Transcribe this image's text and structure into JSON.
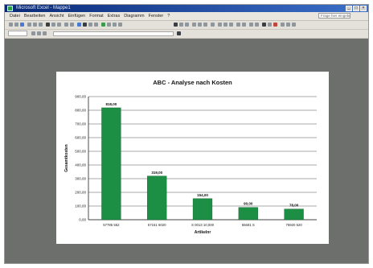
{
  "window": {
    "title": "Microsoft Excel - Mappe1",
    "controls": [
      "_",
      "□",
      "×"
    ]
  },
  "menubar": {
    "items": [
      "Datei",
      "Bearbeiten",
      "Ansicht",
      "Einfügen",
      "Format",
      "Extras",
      "Diagramm",
      "Fenster",
      "?"
    ],
    "help_placeholder": "Frage hier eingeben"
  },
  "chart_data": {
    "type": "bar",
    "title": "ABC - Analyse nach Kosten",
    "xlabel": "Artikelnr",
    "ylabel": "Gesamtkosten",
    "ylim": [
      0,
      900
    ],
    "y_ticks": [
      "0,00",
      "100,00",
      "200,00",
      "300,00",
      "400,00",
      "500,00",
      "600,00",
      "700,00",
      "800,00",
      "900,00"
    ],
    "categories": [
      "57785 552",
      "57161 6020",
      "S 0013 10,000",
      "55681 S",
      "75920 520"
    ],
    "values": [
      818,
      319,
      154,
      90,
      78
    ],
    "value_labels": [
      "818,00",
      "319,00",
      "154,00",
      "90,00",
      "78,00"
    ],
    "bar_color": "#1d8f44",
    "grid": true,
    "legend": "none"
  },
  "colors": {
    "desktop": "#6c6f6c",
    "title_bar": "#0a2a78",
    "bar": "#1d8f44"
  }
}
